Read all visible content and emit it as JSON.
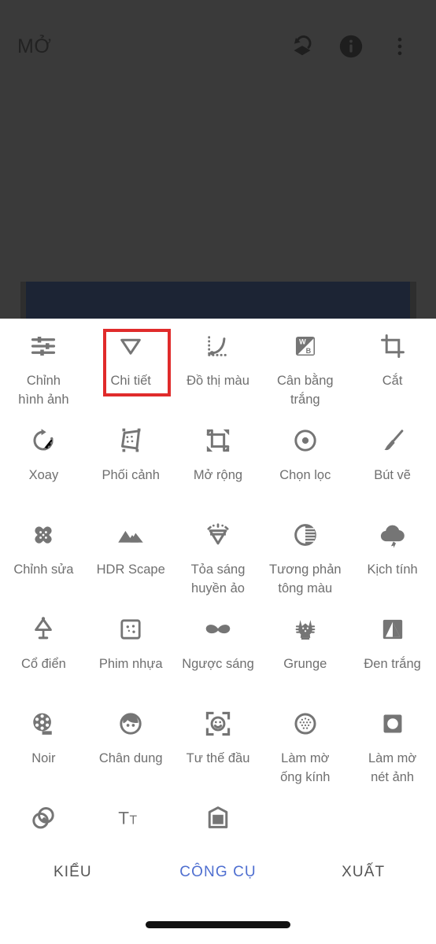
{
  "app": {
    "topbar": {
      "title": "MỞ",
      "actions": [
        {
          "name": "undo-layers-icon",
          "label": "Hoàn tác"
        },
        {
          "name": "info-icon",
          "label": "Thông tin"
        },
        {
          "name": "overflow-menu-icon",
          "label": "Trình đơn"
        }
      ]
    }
  },
  "tools": [
    {
      "label": "Chỉnh\nhình ảnh",
      "icon": "tune-icon"
    },
    {
      "label": "Chi tiết",
      "icon": "triangle-down-icon",
      "highlighted": true
    },
    {
      "label": "Đồ thị màu",
      "icon": "curves-icon"
    },
    {
      "label": "Cân bằng\ntrắng",
      "icon": "white-balance-icon"
    },
    {
      "label": "Cắt",
      "icon": "crop-icon"
    },
    {
      "label": "Xoay",
      "icon": "rotate-icon"
    },
    {
      "label": "Phối cảnh",
      "icon": "perspective-icon"
    },
    {
      "label": "Mở rộng",
      "icon": "expand-icon"
    },
    {
      "label": "Chọn lọc",
      "icon": "selective-icon"
    },
    {
      "label": "Bút vẽ",
      "icon": "brush-icon"
    },
    {
      "label": "Chỉnh sửa",
      "icon": "healing-icon"
    },
    {
      "label": "HDR Scape",
      "icon": "mountains-icon"
    },
    {
      "label": "Tỏa sáng\nhuyền ảo",
      "icon": "glamour-glow-icon"
    },
    {
      "label": "Tương phản\ntông màu",
      "icon": "tonal-contrast-icon"
    },
    {
      "label": "Kịch tính",
      "icon": "drama-cloud-icon"
    },
    {
      "label": "Cổ điển",
      "icon": "vintage-lamp-icon"
    },
    {
      "label": "Phim nhựa",
      "icon": "grainy-film-icon"
    },
    {
      "label": "Ngược sáng",
      "icon": "retrolux-moustache-icon"
    },
    {
      "label": "Grunge",
      "icon": "grunge-icon"
    },
    {
      "label": "Đen trắng",
      "icon": "black-white-icon"
    },
    {
      "label": "Noir",
      "icon": "film-reel-icon"
    },
    {
      "label": "Chân dung",
      "icon": "portrait-face-icon"
    },
    {
      "label": "Tư thế đầu",
      "icon": "head-pose-icon"
    },
    {
      "label": "Làm mờ\nống kính",
      "icon": "lens-blur-icon"
    },
    {
      "label": "Làm mờ\nnét ảnh",
      "icon": "vignette-icon"
    },
    {
      "label": "Phơi sáng\nkép",
      "icon": "double-exposure-icon"
    },
    {
      "label": "Văn bản",
      "icon": "text-icon"
    },
    {
      "label": "Khung",
      "icon": "frames-icon"
    }
  ],
  "tabbar": {
    "tabs": [
      {
        "label": "KIỂU",
        "active": false
      },
      {
        "label": "CÔNG CỤ",
        "active": true
      },
      {
        "label": "XUẤT",
        "active": false
      }
    ]
  },
  "annotations": {
    "color": "#e02b2b",
    "boxes": [
      {
        "name": "highlight-detail-tool",
        "target": "Chi tiết"
      },
      {
        "name": "highlight-tools-tab",
        "target": "CÔNG CỤ"
      }
    ]
  },
  "colors": {
    "background": "#3a3a3a",
    "sheet": "#ffffff",
    "tool_label": "#6f6f6f",
    "active_tab": "#4f6fd0",
    "inactive_tab": "#555555",
    "preview": "#1c2434"
  }
}
